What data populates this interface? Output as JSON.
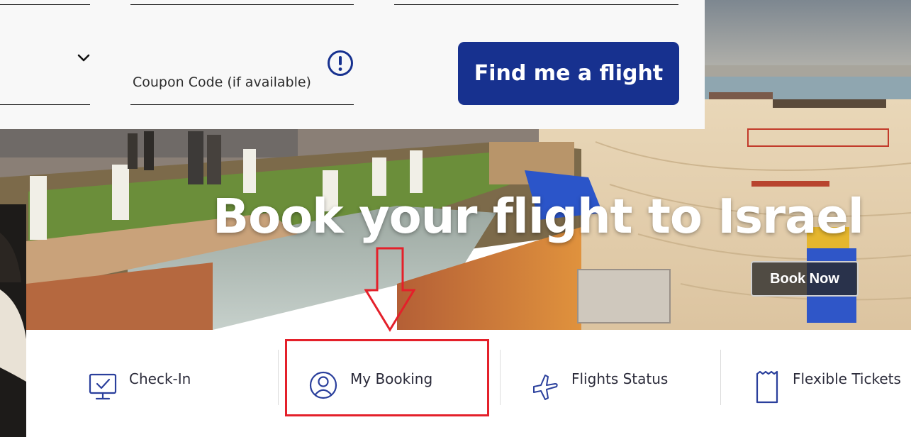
{
  "search_form": {
    "coupon_label": "Coupon Code (if available)",
    "submit_label": "Find me a flight"
  },
  "hero": {
    "title": "Book your flight to Israel",
    "cta_label": "Book Now"
  },
  "quick_links": [
    {
      "label": "Check-In",
      "icon": "monitor-check-icon"
    },
    {
      "label": "My Booking",
      "icon": "user-circle-icon"
    },
    {
      "label": "Flights Status",
      "icon": "airplane-icon"
    },
    {
      "label": "Flexible Tickets",
      "icon": "ticket-icon"
    }
  ],
  "colors": {
    "primary": "#17318f",
    "icon": "#2a3f9c",
    "highlight": "#e4202a"
  }
}
